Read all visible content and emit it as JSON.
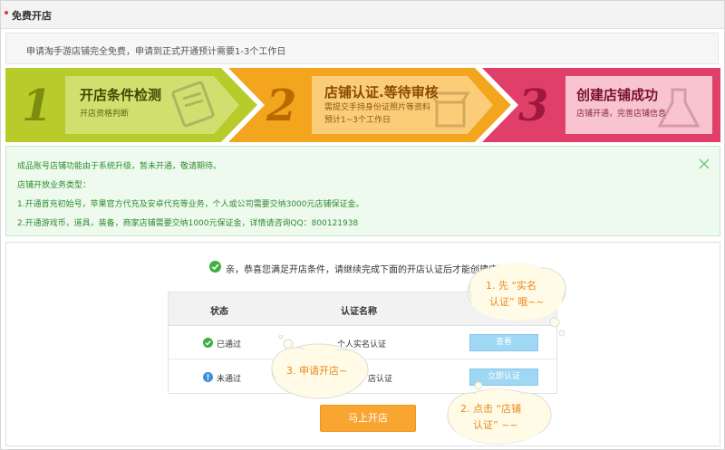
{
  "header": {
    "title": "免费开店"
  },
  "intro": {
    "text": "申请淘手游店铺完全免费，申请到正式开通预计需要1-3个工作日"
  },
  "steps": [
    {
      "number": "1",
      "title": "开店条件检测",
      "desc": [
        "开店资格判断"
      ],
      "color": "#b7cc2a"
    },
    {
      "number": "2",
      "title": "店铺认证.等待审核",
      "desc": [
        "需提交手持身份证照片等资料",
        "预计1~3个工作日"
      ],
      "color": "#f3a51d"
    },
    {
      "number": "3",
      "title": "创建店铺成功",
      "desc": [
        "店铺开通，完善店铺信息"
      ],
      "color": "#e03f69"
    }
  ],
  "notice": {
    "lines": [
      "成品账号店铺功能由于系统升级，暂未开通，敬请期待。",
      "店铺开放业务类型：",
      "1.开通首充初始号，苹果官方代充及安卓代充等业务，个人或公司需要交纳3000元店铺保证金。",
      "2.开通游戏币，道具，装备，商家店铺需要交纳1000元保证金，详情请咨询QQ：800121938"
    ]
  },
  "main": {
    "congrats": "亲，恭喜您满足开店条件，请继续完成下面的开店认证后才能创建店铺！",
    "table": {
      "headers": {
        "status": "状态",
        "name": "认证名称"
      },
      "rows": [
        {
          "status": "已通过",
          "name": "个人实名认证",
          "action": "查看"
        },
        {
          "status": "未通过",
          "name": "店认证",
          "action": "立即认证"
        }
      ]
    },
    "open_button": "马上开店"
  },
  "bubbles": {
    "b1": [
      "1. 先 “实名",
      "认证” 哦~~"
    ],
    "b2": [
      "2. 点击 “店铺",
      "认证” ~~"
    ],
    "b3": [
      "3. 申请开店~"
    ]
  },
  "colors": {
    "pass": "#3fae3f",
    "fail": "#3d8fd8",
    "accent": "#f9a532",
    "notice_text": "#2e8b2e"
  }
}
